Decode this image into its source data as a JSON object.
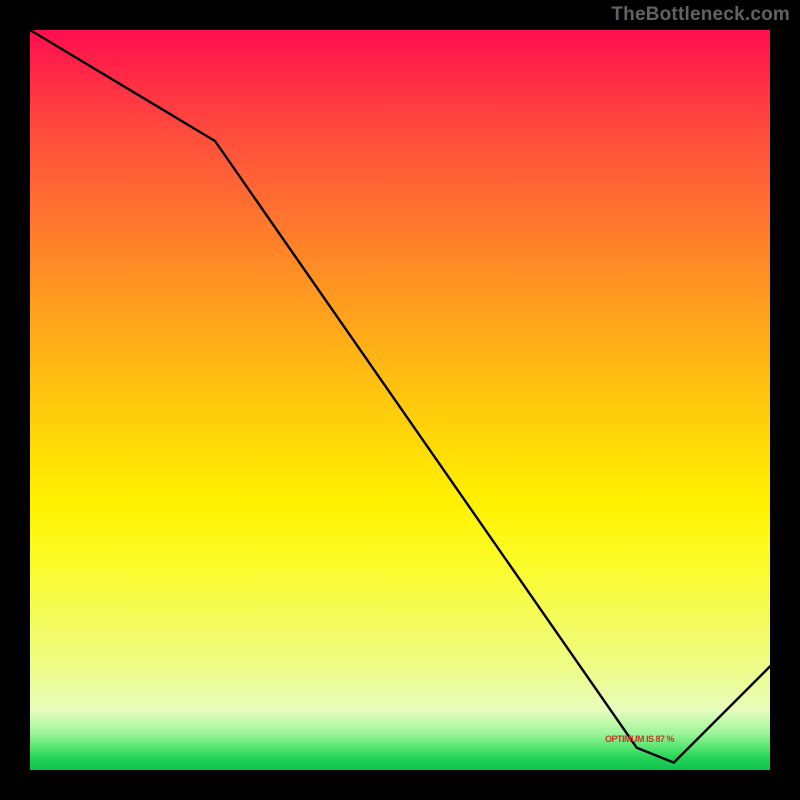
{
  "watermark": "TheBottleneck.com",
  "annotation": "OPTIMUM IS 87 %",
  "chart_data": {
    "type": "line",
    "title": "",
    "xlabel": "",
    "ylabel": "",
    "xlim": [
      0,
      100
    ],
    "ylim": [
      0,
      100
    ],
    "x": [
      0,
      25,
      82,
      87,
      100
    ],
    "values": [
      100,
      85,
      3,
      1,
      14
    ],
    "annotations": [
      {
        "text": "OPTIMUM IS 87 %",
        "x": 82,
        "y": 4
      }
    ],
    "colormap": "red-yellow-green vertical heat gradient",
    "gridlines": false,
    "legend": false
  }
}
